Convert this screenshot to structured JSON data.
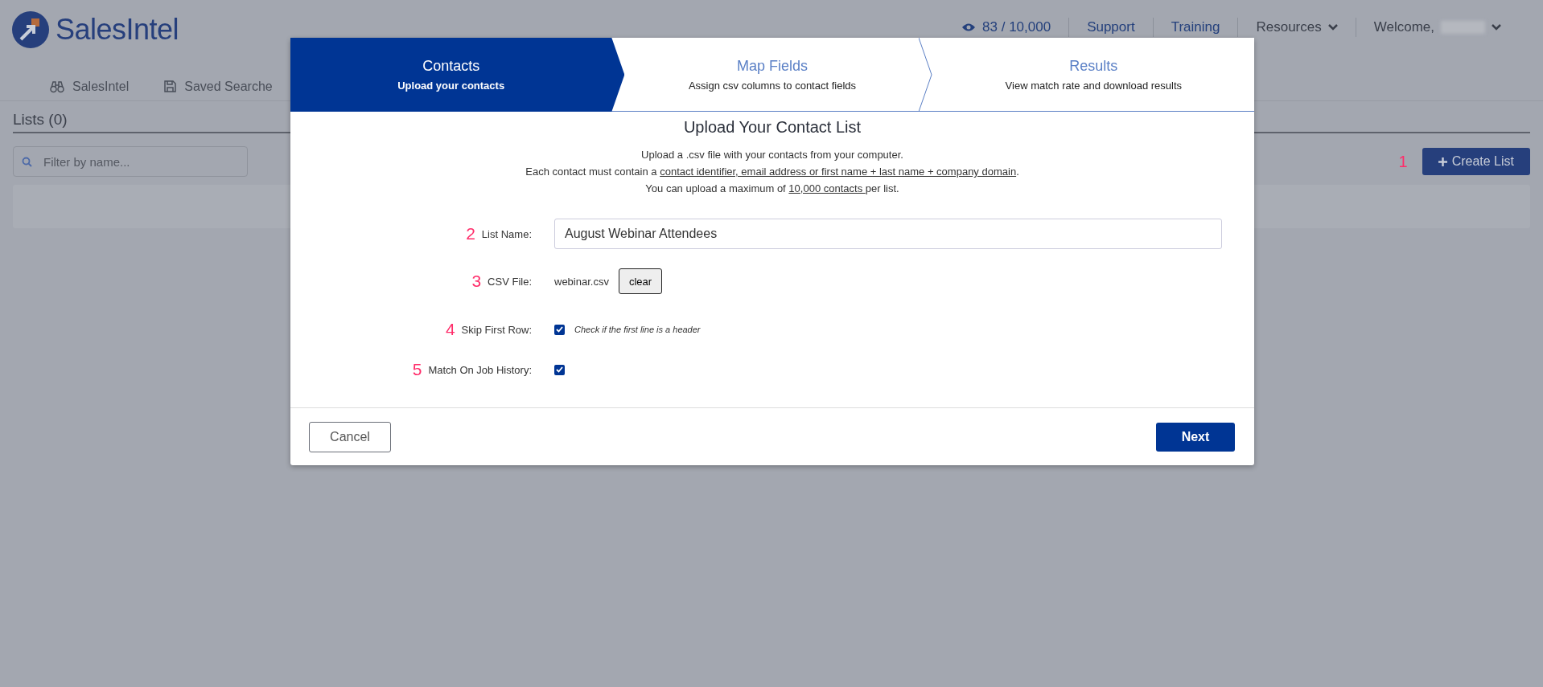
{
  "header": {
    "logo": "SalesIntel",
    "nav": [
      {
        "label": "SalesIntel"
      },
      {
        "label": "Saved Searche"
      }
    ],
    "usage": "83 / 10,000",
    "links": [
      "Support",
      "Training"
    ],
    "menus": [
      "Resources",
      "Welcome,"
    ]
  },
  "lists": {
    "title": "Lists (0)",
    "filter": {
      "placeholder": "Filter by name..."
    },
    "create_button": "Create List",
    "create_marker": "1"
  },
  "modal": {
    "steps": [
      {
        "title": "Contacts",
        "subtitle": "Upload your contacts",
        "selected": true
      },
      {
        "title": "Map Fields",
        "subtitle": "Assign csv columns to contact fields",
        "selected": false
      },
      {
        "title": "Results",
        "subtitle": "View match rate and download results",
        "selected": false
      }
    ],
    "heading": "Upload Your Contact List",
    "lines": [
      {
        "before": "Upload a .csv file with your contacts from your computer."
      },
      {
        "before": "Each contact must contain a ",
        "link": "contact identifier, email address or first name + last name + company domain",
        "after": "."
      },
      {
        "before": "You can upload a maximum of ",
        "link": "10,000 contacts ",
        "after": "per list."
      }
    ],
    "fields": [
      {
        "kind": "text",
        "marker": "2",
        "label": "List Name:",
        "value": "August Webinar Attendees"
      },
      {
        "kind": "file",
        "marker": "3",
        "label": "CSV File:",
        "value": "webinar.csv",
        "button": "clear"
      },
      {
        "kind": "checkbox",
        "marker": "4",
        "label": "Skip First Row:",
        "checked": true,
        "hint": "Check if the first line is a header"
      },
      {
        "kind": "checkbox",
        "marker": "5",
        "label": "Match On Job History:",
        "checked": true
      }
    ],
    "cancel": "Cancel",
    "next": "Next"
  }
}
